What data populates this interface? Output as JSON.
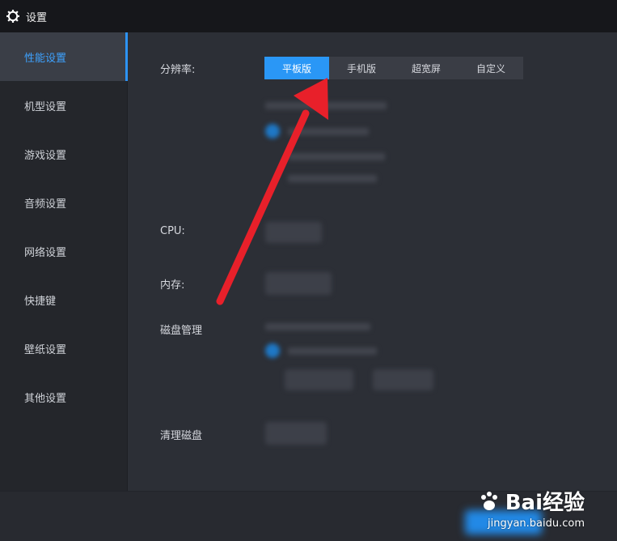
{
  "window": {
    "title": "设置",
    "icon": "gear-icon"
  },
  "sidebar": {
    "items": [
      {
        "label": "性能设置",
        "active": true
      },
      {
        "label": "机型设置",
        "active": false
      },
      {
        "label": "游戏设置",
        "active": false
      },
      {
        "label": "音频设置",
        "active": false
      },
      {
        "label": "网络设置",
        "active": false
      },
      {
        "label": "快捷键",
        "active": false
      },
      {
        "label": "壁纸设置",
        "active": false
      },
      {
        "label": "其他设置",
        "active": false
      }
    ]
  },
  "main": {
    "resolution": {
      "label": "分辨率:",
      "options": [
        "平板版",
        "手机版",
        "超宽屏",
        "自定义"
      ],
      "selected": "平板版"
    },
    "cpu_label": "CPU:",
    "memory_label": "内存:",
    "disk_label": "磁盘管理",
    "clean_disk_label": "清理磁盘"
  },
  "colors": {
    "accent": "#2a97f6",
    "active_text": "#3ea2ff",
    "titlebar": "#16171b",
    "sidebar": "#24262b",
    "content": "#2c2f36",
    "annotation_arrow": "#e8202a"
  },
  "watermark": {
    "brand": "Bai经验",
    "url": "jingyan.baidu.com",
    "icon": "baidu-paw-icon"
  }
}
